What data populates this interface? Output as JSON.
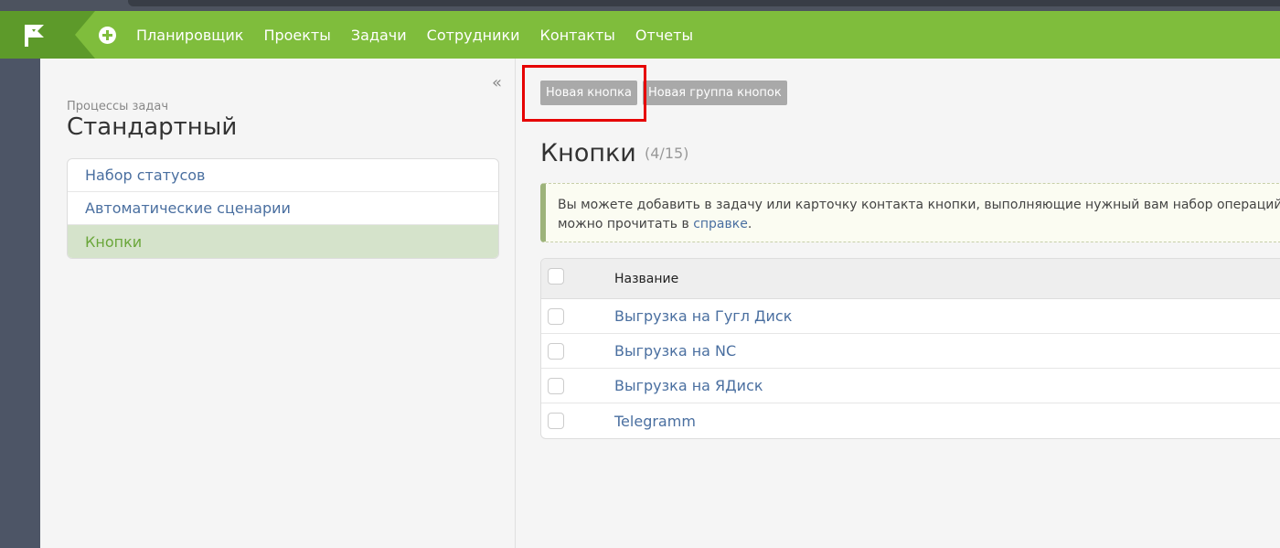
{
  "nav": {
    "items": [
      "Планировщик",
      "Проекты",
      "Задачи",
      "Сотрудники",
      "Контакты",
      "Отчеты"
    ]
  },
  "sidebar": {
    "collapse": "«",
    "subtitle": "Процессы задач",
    "title": "Стандартный",
    "items": [
      {
        "label": "Набор статусов",
        "active": false
      },
      {
        "label": "Автоматические сценарии",
        "active": false
      },
      {
        "label": "Кнопки",
        "active": true
      }
    ]
  },
  "toolbar": {
    "new_button": "Новая кнопка",
    "new_group_button": "Новая группа кнопок"
  },
  "heading": {
    "title": "Кнопки",
    "count": "(4/15)"
  },
  "info": {
    "line1": "Вы можете добавить в задачу или карточку контакта кнопки, выполняющие нужный вам набор операций",
    "line2_prefix": "можно прочитать в ",
    "link": "справке",
    "line2_suffix": "."
  },
  "table": {
    "header": "Название",
    "rows": [
      "Выгрузка на Гугл Диск",
      "Выгрузка на NC",
      "Выгрузка на ЯДиск",
      "Telegramm"
    ]
  },
  "colors": {
    "accent": "#7fbd3c",
    "accent_dark": "#5d9a2a",
    "link": "#4a6fa0",
    "highlight": "#e60000"
  }
}
